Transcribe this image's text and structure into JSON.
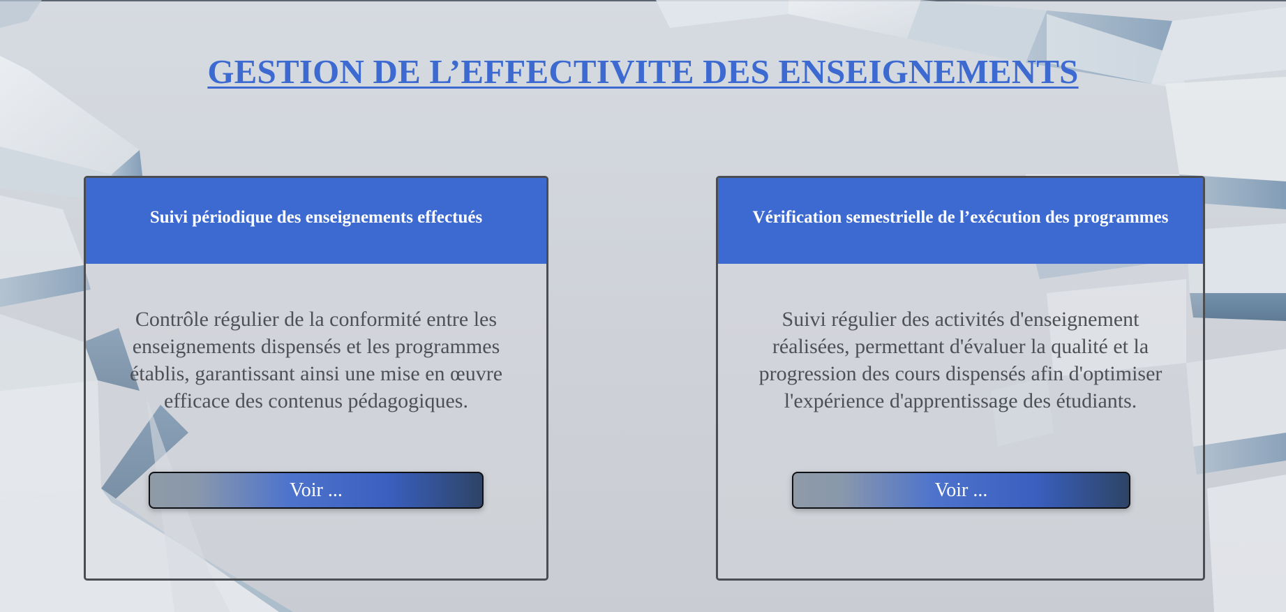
{
  "page": {
    "title": "GESTION DE L’EFFECTIVITE DES ENSEIGNEMENTS"
  },
  "cards": [
    {
      "header": "Suivi périodique des enseignements effectués",
      "description": "Contrôle régulier de la conformité entre les enseignements dispensés et les programmes établis, garantissant ainsi une mise en œuvre efficace des contenus pédagogiques.",
      "button_label": "Voir ..."
    },
    {
      "header": "Vérification semestrielle de l’exécution des programmes",
      "description": "Suivi régulier des activités d'enseignement réalisées, permettant d'évaluer la qualité et la progression des cours dispensés afin d'optimiser l'expérience d'apprentissage des étudiants.",
      "button_label": "Voir ..."
    }
  ],
  "colors": {
    "accent": "#3d6ad1",
    "card_border": "#4a4d52",
    "body_text": "#4d5055"
  }
}
